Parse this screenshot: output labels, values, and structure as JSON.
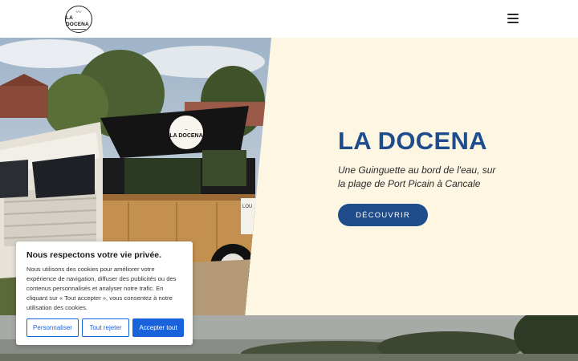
{
  "header": {
    "logo_text": "LA DOCENA",
    "menu_icon": "hamburger-menu-icon"
  },
  "hero": {
    "title": "LA DOCENA",
    "subtitle": "Une Guinguette au bord de l'eau, sur la plage de Port Picain à Cancale",
    "cta_label": "DÉCOUVRIR",
    "truck_sign_text": "LA DOCENA",
    "truck_side_text": "LOU",
    "accent_color": "#1f4d8c",
    "background_color": "#fdf6e3"
  },
  "cookie_banner": {
    "title": "Nous respectons votre vie privée.",
    "text": "Nous utilisons des cookies pour améliorer votre expérience de navigation, diffuser des publicités ou des contenus personnalisés et analyser notre trafic. En cliquant sur « Tout accepter », vous consentez à notre utilisation des cookies.",
    "buttons": {
      "customize": "Personnaliser",
      "reject": "Tout rejeter",
      "accept": "Accepter tout"
    },
    "button_color": "#1863dc"
  }
}
